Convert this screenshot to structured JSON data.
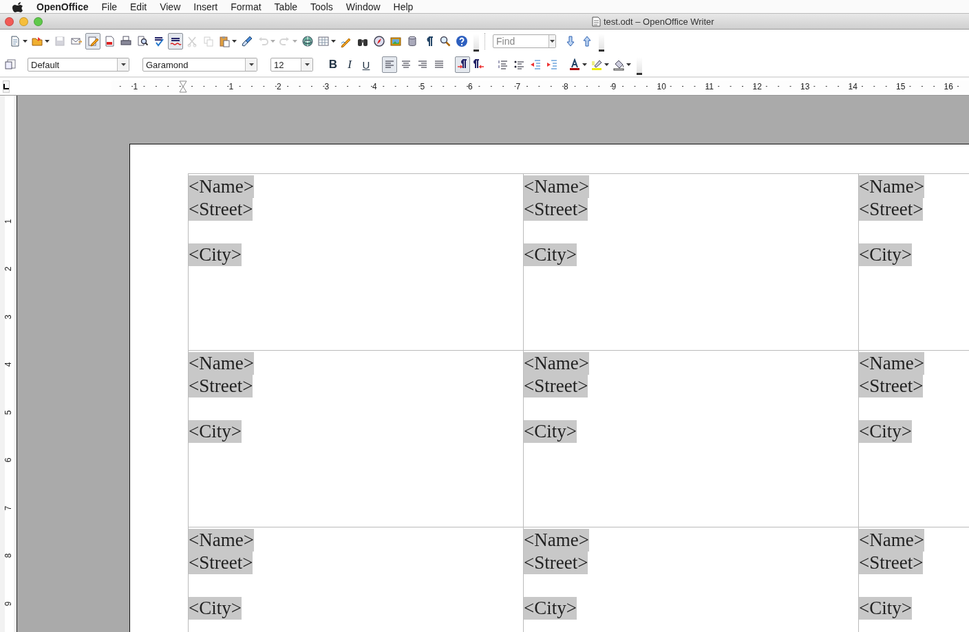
{
  "menu_bar": {
    "app_name": "OpenOffice",
    "items": [
      "File",
      "Edit",
      "View",
      "Insert",
      "Format",
      "Table",
      "Tools",
      "Window",
      "Help"
    ]
  },
  "window": {
    "title": "test.odt – OpenOffice Writer"
  },
  "standard_toolbar": {
    "items": [
      {
        "kind": "new",
        "dropdown": true,
        "disabled": false,
        "selected": false
      },
      {
        "kind": "open",
        "dropdown": true,
        "disabled": false,
        "selected": false
      },
      {
        "kind": "save",
        "dropdown": false,
        "disabled": true,
        "selected": false
      },
      {
        "kind": "email",
        "dropdown": false,
        "disabled": false,
        "selected": false
      },
      {
        "kind": "edit",
        "dropdown": false,
        "disabled": false,
        "selected": true
      },
      {
        "kind": "pdf",
        "dropdown": false,
        "disabled": false,
        "selected": false
      },
      {
        "kind": "print",
        "dropdown": false,
        "disabled": false,
        "selected": false
      },
      {
        "kind": "preview",
        "dropdown": false,
        "disabled": false,
        "selected": false
      },
      {
        "kind": "spellcheck",
        "dropdown": false,
        "disabled": false,
        "selected": false
      },
      {
        "kind": "autospell",
        "dropdown": false,
        "disabled": false,
        "selected": true
      },
      {
        "kind": "cut",
        "dropdown": false,
        "disabled": true,
        "selected": false
      },
      {
        "kind": "copy",
        "dropdown": false,
        "disabled": true,
        "selected": false
      },
      {
        "kind": "paste",
        "dropdown": true,
        "disabled": false,
        "selected": false
      },
      {
        "kind": "clone",
        "dropdown": false,
        "disabled": false,
        "selected": false
      },
      {
        "kind": "undo",
        "dropdown": true,
        "disabled": true,
        "selected": false
      },
      {
        "kind": "redo",
        "dropdown": true,
        "disabled": true,
        "selected": false
      },
      {
        "kind": "hyperlink",
        "dropdown": false,
        "disabled": false,
        "selected": false
      },
      {
        "kind": "table",
        "dropdown": true,
        "disabled": false,
        "selected": false
      },
      {
        "kind": "draw",
        "dropdown": false,
        "disabled": false,
        "selected": false
      },
      {
        "kind": "find",
        "dropdown": false,
        "disabled": false,
        "selected": false
      },
      {
        "kind": "navigator",
        "dropdown": false,
        "disabled": false,
        "selected": false
      },
      {
        "kind": "gallery",
        "dropdown": false,
        "disabled": false,
        "selected": false
      },
      {
        "kind": "database",
        "dropdown": false,
        "disabled": false,
        "selected": false
      },
      {
        "kind": "marks",
        "dropdown": false,
        "disabled": false,
        "selected": false
      },
      {
        "kind": "zoom",
        "dropdown": false,
        "disabled": false,
        "selected": false
      },
      {
        "kind": "help",
        "dropdown": false,
        "disabled": false,
        "selected": false
      }
    ],
    "find_field": {
      "placeholder": "Find"
    }
  },
  "formatting_toolbar": {
    "paragraph_style": "Default",
    "font_name": "Garamond",
    "font_size": "12",
    "items": [
      {
        "kind": "bold",
        "label": "B",
        "selected": false
      },
      {
        "kind": "italic",
        "label": "I",
        "selected": false
      },
      {
        "kind": "underline",
        "label": "U",
        "selected": false
      },
      {
        "kind": "align-left",
        "dropdown": false,
        "selected": true
      },
      {
        "kind": "align-center",
        "dropdown": false,
        "selected": false
      },
      {
        "kind": "align-right",
        "dropdown": false,
        "selected": false
      },
      {
        "kind": "justify",
        "dropdown": false,
        "selected": false
      },
      {
        "kind": "ltr",
        "dropdown": false,
        "selected": true
      },
      {
        "kind": "rtl",
        "dropdown": false,
        "selected": false
      },
      {
        "kind": "numbering",
        "dropdown": false,
        "selected": false
      },
      {
        "kind": "bullets",
        "dropdown": false,
        "selected": false
      },
      {
        "kind": "indent-less",
        "dropdown": false,
        "selected": false
      },
      {
        "kind": "indent-more",
        "dropdown": false,
        "selected": false
      },
      {
        "kind": "font-color",
        "dropdown": true,
        "selected": false
      },
      {
        "kind": "highlight",
        "dropdown": true,
        "selected": false
      },
      {
        "kind": "background",
        "dropdown": true,
        "selected": false
      }
    ]
  },
  "horizontal_ruler": {
    "left_label": "1",
    "labels": [
      "1",
      "2",
      "3",
      "4",
      "5",
      "6",
      "7",
      "8",
      "9",
      "10",
      "11",
      "12",
      "13",
      "14",
      "15",
      "16"
    ]
  },
  "vertical_ruler": {
    "labels": [
      "1",
      "2",
      "3",
      "4",
      "5",
      "6",
      "7",
      "8",
      "9"
    ]
  },
  "labels_table": {
    "rows": [
      [
        {
          "name": "<Name>",
          "street": "<Street>",
          "city": "<City>"
        },
        {
          "name": "<Name>",
          "street": "<Street>",
          "city": "<City>"
        },
        {
          "name": "<Name>",
          "street": "<Street>",
          "city": "<City>"
        }
      ],
      [
        {
          "name": "<Name>",
          "street": "<Street>",
          "city": "<City>"
        },
        {
          "name": "<Name>",
          "street": "<Street>",
          "city": "<City>"
        },
        {
          "name": "<Name>",
          "street": "<Street>",
          "city": "<City>"
        }
      ],
      [
        {
          "name": "<Name>",
          "street": "<Street>",
          "city": "<City>"
        },
        {
          "name": "<Name>",
          "street": "<Street>",
          "city": "<City>"
        },
        {
          "name": "<Name>",
          "street": "<Street>",
          "city": "<City>"
        }
      ]
    ]
  }
}
